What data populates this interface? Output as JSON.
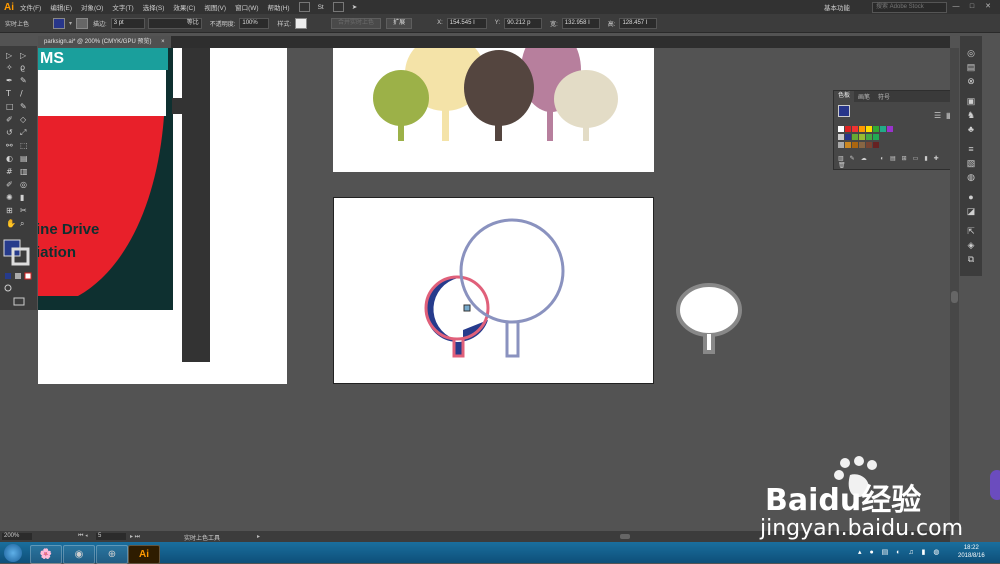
{
  "app": {
    "logo": "Ai"
  },
  "menu": [
    "文件(F)",
    "编辑(E)",
    "对象(O)",
    "文字(T)",
    "选择(S)",
    "效果(C)",
    "视图(V)",
    "窗口(W)",
    "帮助(H)"
  ],
  "menu_icons": [
    "Br",
    "St"
  ],
  "workspace": {
    "label": "基本功能",
    "search_placeholder": "搜索 Adobe Stock"
  },
  "control": {
    "mode": "实时上色",
    "fill_color": "#28368a",
    "stroke_label": "描边:",
    "stroke_value": "3 pt",
    "stroke_style": "等比",
    "opacity_label": "不透明度:",
    "opacity_value": "100%",
    "style_label": "样式:",
    "btn_merge": "合并实时上色",
    "btn_expand": "扩展",
    "x_label": "X:",
    "x_value": "154.545 I",
    "y_label": "Y:",
    "y_value": "90.212 p",
    "w_label": "宽:",
    "w_value": "132.958 I",
    "h_label": "高:",
    "h_value": "128.457 I"
  },
  "doc_tab": {
    "title": "parksign.ai* @ 200% (CMYK/GPU 预览)",
    "close": "×"
  },
  "poster": {
    "line1": "ine Drive",
    "line2": "iation",
    "top": "MS"
  },
  "swatches_panel": {
    "tabs": [
      "色板",
      "画笔",
      "符号"
    ]
  },
  "status": {
    "zoom": "200%",
    "page": "5",
    "tool": "实时上色工具"
  },
  "clock": {
    "time": "18:22",
    "date": "2018/8/16"
  },
  "watermark": {
    "brand": "Baidu经验",
    "url": "jingyan.baidu.com"
  },
  "colors": {
    "olive": "#9cb148",
    "cream": "#f4e3a8",
    "brown": "#54453f",
    "mauve": "#b77f9d",
    "beige": "#e3dcc6",
    "navy": "#263b8c",
    "blue_outline": "#8a92bf",
    "pink_outline": "#e0607a"
  }
}
